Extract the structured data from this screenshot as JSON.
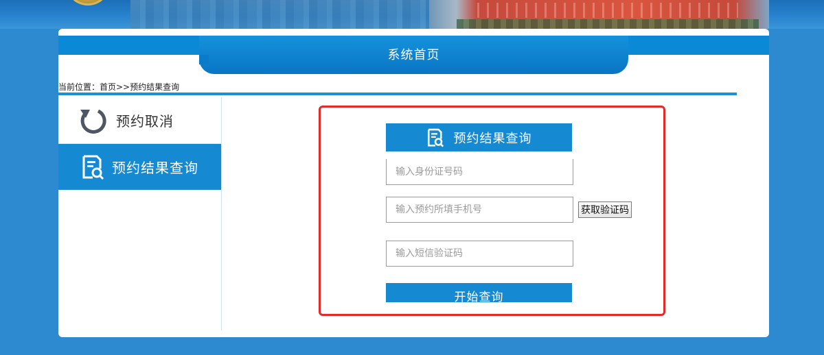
{
  "header": {
    "title": "系统首页"
  },
  "breadcrumb": {
    "text": "当前位置：首页>>预约结果查询"
  },
  "sidebar": {
    "items": [
      {
        "label": "预约取消",
        "icon": "refresh-icon",
        "active": false
      },
      {
        "label": "预约结果查询",
        "icon": "document-search-icon",
        "active": true
      }
    ]
  },
  "query_panel": {
    "title": "预约结果查询",
    "title_icon": "document-search-icon",
    "id_number": {
      "value": "",
      "placeholder": "输入身份证号码"
    },
    "phone": {
      "value": "",
      "placeholder": "输入预约所填手机号"
    },
    "sms_code": {
      "value": "",
      "placeholder": "输入短信验证码"
    },
    "get_code_label": "获取验证码",
    "submit_label": "开始查询"
  },
  "colors": {
    "page_background": "#2e8ad0",
    "accent_blue": "#1689d3",
    "highlight_red": "#e02b2b",
    "icon_gray": "#4e5563"
  }
}
